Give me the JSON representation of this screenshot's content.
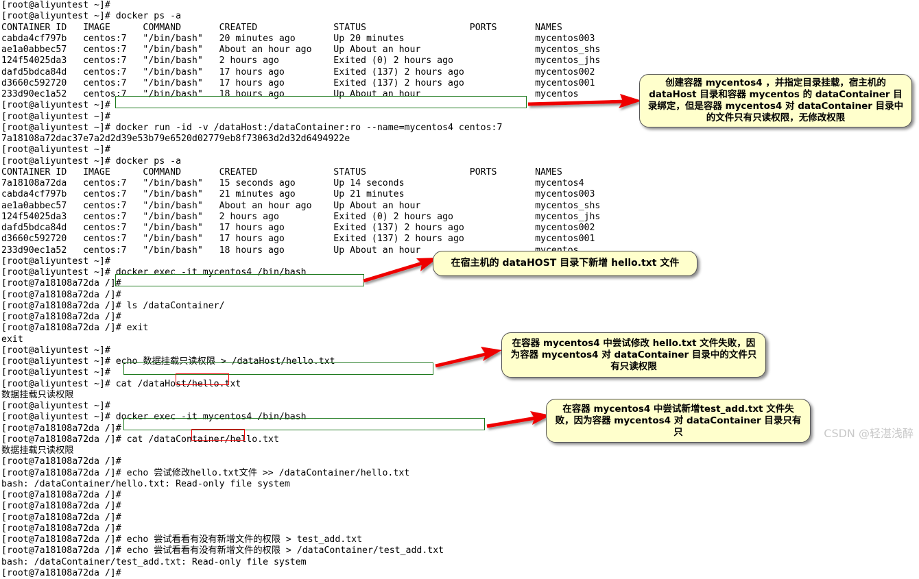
{
  "colors": {
    "background": "#ffffff",
    "text": "#000000",
    "highlight_green": "#1f7a1f",
    "highlight_red": "#ee0000",
    "callout_fill": "#ffffcc",
    "callout_border": "#555555",
    "arrow": "#ee0000",
    "watermark": "#c9c9c9"
  },
  "terminal": {
    "host_prompt": "[root@aliyuntest ~]#",
    "container_prompt": "[root@7a18108a72da /]#",
    "lines": [
      "[root@aliyuntest ~]#",
      "[root@aliyuntest ~]# docker ps -a",
      "CONTAINER ID   IMAGE      COMMAND       CREATED              STATUS                   PORTS       NAMES",
      "cabda4cf797b   centos:7   \"/bin/bash\"   20 minutes ago       Up 20 minutes                        mycentos003",
      "ae1a0abbec57   centos:7   \"/bin/bash\"   About an hour ago    Up About an hour                     mycentos_shs",
      "124f54025da3   centos:7   \"/bin/bash\"   2 hours ago          Exited (0) 2 hours ago               mycentos_jhs",
      "dafd5bdca84d   centos:7   \"/bin/bash\"   17 hours ago         Exited (137) 2 hours ago             mycentos002",
      "d3660c592720   centos:7   \"/bin/bash\"   17 hours ago         Exited (137) 2 hours ago             mycentos001",
      "233d90ec1a52   centos:7   \"/bin/bash\"   18 hours ago         Up About an hour                     mycentos",
      "[root@aliyuntest ~]#",
      "[root@aliyuntest ~]#",
      "[root@aliyuntest ~]# docker run -id -v /dataHost:/dataContainer:ro --name=mycentos4 centos:7",
      "7a18108a72dac37e7a2d2d39e53b79e6520d02779eb8f73063d2d32d6494922e",
      "[root@aliyuntest ~]#",
      "[root@aliyuntest ~]# docker ps -a",
      "CONTAINER ID   IMAGE      COMMAND       CREATED              STATUS                   PORTS       NAMES",
      "7a18108a72da   centos:7   \"/bin/bash\"   15 seconds ago       Up 14 seconds                        mycentos4",
      "cabda4cf797b   centos:7   \"/bin/bash\"   21 minutes ago       Up 21 minutes                        mycentos003",
      "ae1a0abbec57   centos:7   \"/bin/bash\"   About an hour ago    Up About an hour                     mycentos_shs",
      "124f54025da3   centos:7   \"/bin/bash\"   2 hours ago          Exited (0) 2 hours ago               mycentos_jhs",
      "dafd5bdca84d   centos:7   \"/bin/bash\"   17 hours ago         Exited (137) 2 hours ago             mycentos002",
      "d3660c592720   centos:7   \"/bin/bash\"   17 hours ago         Exited (137) 2 hours ago             mycentos001",
      "233d90ec1a52   centos:7   \"/bin/bash\"   18 hours ago         Up About an hour                     mycentos",
      "[root@aliyuntest ~]#",
      "[root@aliyuntest ~]# docker exec -it mycentos4 /bin/bash",
      "[root@7a18108a72da /]#",
      "[root@7a18108a72da /]#",
      "[root@7a18108a72da /]# ls /dataContainer/",
      "[root@7a18108a72da /]#",
      "[root@7a18108a72da /]# exit",
      "exit",
      "[root@aliyuntest ~]#",
      "[root@aliyuntest ~]# echo 数据挂载只读权限 > /dataHost/hello.txt",
      "[root@aliyuntest ~]#",
      "[root@aliyuntest ~]# cat /dataHost/hello.txt",
      "数据挂载只读权限",
      "[root@aliyuntest ~]#",
      "[root@aliyuntest ~]# docker exec -it mycentos4 /bin/bash",
      "[root@7a18108a72da /]#",
      "[root@7a18108a72da /]# cat /dataContainer/hello.txt",
      "数据挂载只读权限",
      "[root@7a18108a72da /]#",
      "[root@7a18108a72da /]# echo 尝试修改hello.txt文件 >> /dataContainer/hello.txt",
      "bash: /dataContainer/hello.txt: Read-only file system",
      "[root@7a18108a72da /]#",
      "[root@7a18108a72da /]#",
      "[root@7a18108a72da /]#",
      "[root@7a18108a72da /]#",
      "[root@7a18108a72da /]# echo 尝试看看有没有新增文件的权限 > test_add.txt",
      "[root@7a18108a72da /]# echo 尝试看看有没有新增文件的权限 > /dataContainer/test_add.txt",
      "bash: /dataContainer/test_add.txt: Read-only file system",
      "[root@7a18108a72da /]#"
    ],
    "table_headers": [
      "CONTAINER ID",
      "IMAGE",
      "COMMAND",
      "CREATED",
      "STATUS",
      "PORTS",
      "NAMES"
    ]
  },
  "highlights": [
    {
      "name": "docker-run-command",
      "text": "docker run -id -v /dataHost:/dataContainer:ro --name=mycentos4 centos:7",
      "kind": "green"
    },
    {
      "name": "echo-hello-host-command",
      "text": "echo 数据挂载只读权限 > /dataHost/hello.txt",
      "kind": "green"
    },
    {
      "name": "echo-modify-hello-command",
      "text": "echo 尝试修改hello.txt文件 >> /dataContainer/hello.txt",
      "kind": "green"
    },
    {
      "name": "read-only-error-1",
      "text": "Read-only",
      "kind": "red"
    },
    {
      "name": "echo-test-add-command",
      "text": "echo 尝试看看有没有新增文件的权限 > /dataContainer/test_add.txt",
      "kind": "green"
    },
    {
      "name": "read-only-error-2",
      "text": "Read-only",
      "kind": "red"
    }
  ],
  "callouts": {
    "create_container": "创建容器 mycentos4 ，并指定目录挂载，宿主机的 dataHost 目录和容器 mycentos 的 dataContainer 目录绑定，但是容器 mycentos4 对 dataContainer 目录中的文件只有只读权限，无修改权限",
    "add_hello_on_host": "在宿主机的 dataHOST 目录下新增 hello.txt 文件",
    "modify_fail": "在容器 mycentos4 中尝试修改 hello.txt 文件失败，因为容器 mycentos4 对 dataContainer 目录中的文件只有只读权限",
    "add_fail": "在容器 mycentos4 中尝试新增test_add.txt 文件失败，因为容器 mycentos4 对 dataContainer 目录只有只"
  },
  "watermark": "CSDN @轻湛浅醉"
}
